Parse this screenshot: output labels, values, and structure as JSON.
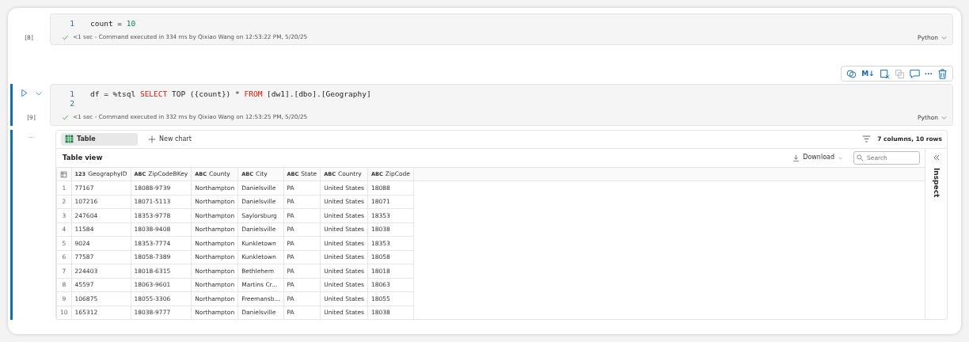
{
  "cells": [
    {
      "exec_count": "[8]",
      "active": false,
      "lines": [
        {
          "number": "1",
          "tokens": [
            {
              "text": "count = ",
              "kind": "plain"
            },
            {
              "text": "10",
              "kind": "number"
            }
          ]
        }
      ],
      "status": "<1 sec - Command executed in 334 ms by Qixiao Wang on 12:53:22 PM, 5/20/25",
      "succeeded": true,
      "language": "Python"
    },
    {
      "exec_count": "[9]",
      "active": true,
      "lines": [
        {
          "number": "1",
          "tokens": [
            {
              "text": "df = %tsql ",
              "kind": "plain"
            },
            {
              "text": "SELECT",
              "kind": "keyword"
            },
            {
              "text": " TOP ({count}) * ",
              "kind": "plain"
            },
            {
              "text": "FROM",
              "kind": "keyword"
            },
            {
              "text": " [dw1].[dbo].[Geography]",
              "kind": "plain"
            }
          ]
        },
        {
          "number": "2"
        }
      ],
      "status": "<1 sec - Command executed in 332 ms by Qixiao Wang on 12:53:25 PM, 5/20/25",
      "succeeded": true,
      "language": "Python",
      "toolbar": [
        {
          "kind": "copilot",
          "disabled": false
        },
        {
          "kind": "markdown",
          "label": "M↓",
          "disabled": false
        },
        {
          "kind": "clear",
          "disabled": false
        },
        {
          "kind": "duplicate",
          "disabled": true
        },
        {
          "kind": "comment",
          "disabled": false
        },
        {
          "kind": "more",
          "label": "···",
          "disabled": false
        },
        {
          "kind": "delete",
          "disabled": false
        }
      ],
      "output": {
        "more_label": "···",
        "tabs": [
          {
            "label": "Table",
            "kind": "table",
            "selected": true
          },
          {
            "label": "New chart",
            "kind": "add",
            "selected": false
          }
        ],
        "summary": "7 columns, 10 rows",
        "view_title": "Table view",
        "download_label": "Download",
        "search": {
          "placeholder": "Search"
        },
        "inspect_label": "Inspect",
        "table": {
          "columns": [
            {
              "type": "123",
              "name": "GeographyID"
            },
            {
              "type": "ABC",
              "name": "ZipCodeBKey"
            },
            {
              "type": "ABC",
              "name": "County"
            },
            {
              "type": "ABC",
              "name": "City"
            },
            {
              "type": "ABC",
              "name": "State"
            },
            {
              "type": "ABC",
              "name": "Country"
            },
            {
              "type": "ABC",
              "name": "ZipCode"
            }
          ],
          "rows": [
            {
              "number": "1",
              "values": [
                "77167",
                "18088-9739",
                "Northampton",
                "Danielsville",
                "PA",
                "United States",
                "18088"
              ]
            },
            {
              "number": "2",
              "values": [
                "107216",
                "18071-5113",
                "Northampton",
                "Danielsville",
                "PA",
                "United States",
                "18071"
              ]
            },
            {
              "number": "3",
              "values": [
                "247604",
                "18353-9778",
                "Northampton",
                "Saylorsburg",
                "PA",
                "United States",
                "18353"
              ]
            },
            {
              "number": "4",
              "values": [
                "11584",
                "18038-9408",
                "Northampton",
                "Danielsville",
                "PA",
                "United States",
                "18038"
              ]
            },
            {
              "number": "5",
              "values": [
                "9024",
                "18353-7774",
                "Northampton",
                "Kunkletown",
                "PA",
                "United States",
                "18353"
              ]
            },
            {
              "number": "6",
              "values": [
                "77587",
                "18058-7389",
                "Northampton",
                "Kunkletown",
                "PA",
                "United States",
                "18058"
              ]
            },
            {
              "number": "7",
              "values": [
                "224403",
                "18018-6315",
                "Northampton",
                "Bethlehem",
                "PA",
                "United States",
                "18018"
              ]
            },
            {
              "number": "8",
              "values": [
                "45597",
                "18063-9601",
                "Northampton",
                "Martins Cr...",
                "PA",
                "United States",
                "18063"
              ]
            },
            {
              "number": "9",
              "values": [
                "106875",
                "18055-3306",
                "Northampton",
                "Freemansb...",
                "PA",
                "United States",
                "18055"
              ]
            },
            {
              "number": "10",
              "values": [
                "165312",
                "18038-9777",
                "Northampton",
                "Danielsville",
                "PA",
                "United States",
                "18038"
              ]
            }
          ]
        }
      }
    }
  ]
}
